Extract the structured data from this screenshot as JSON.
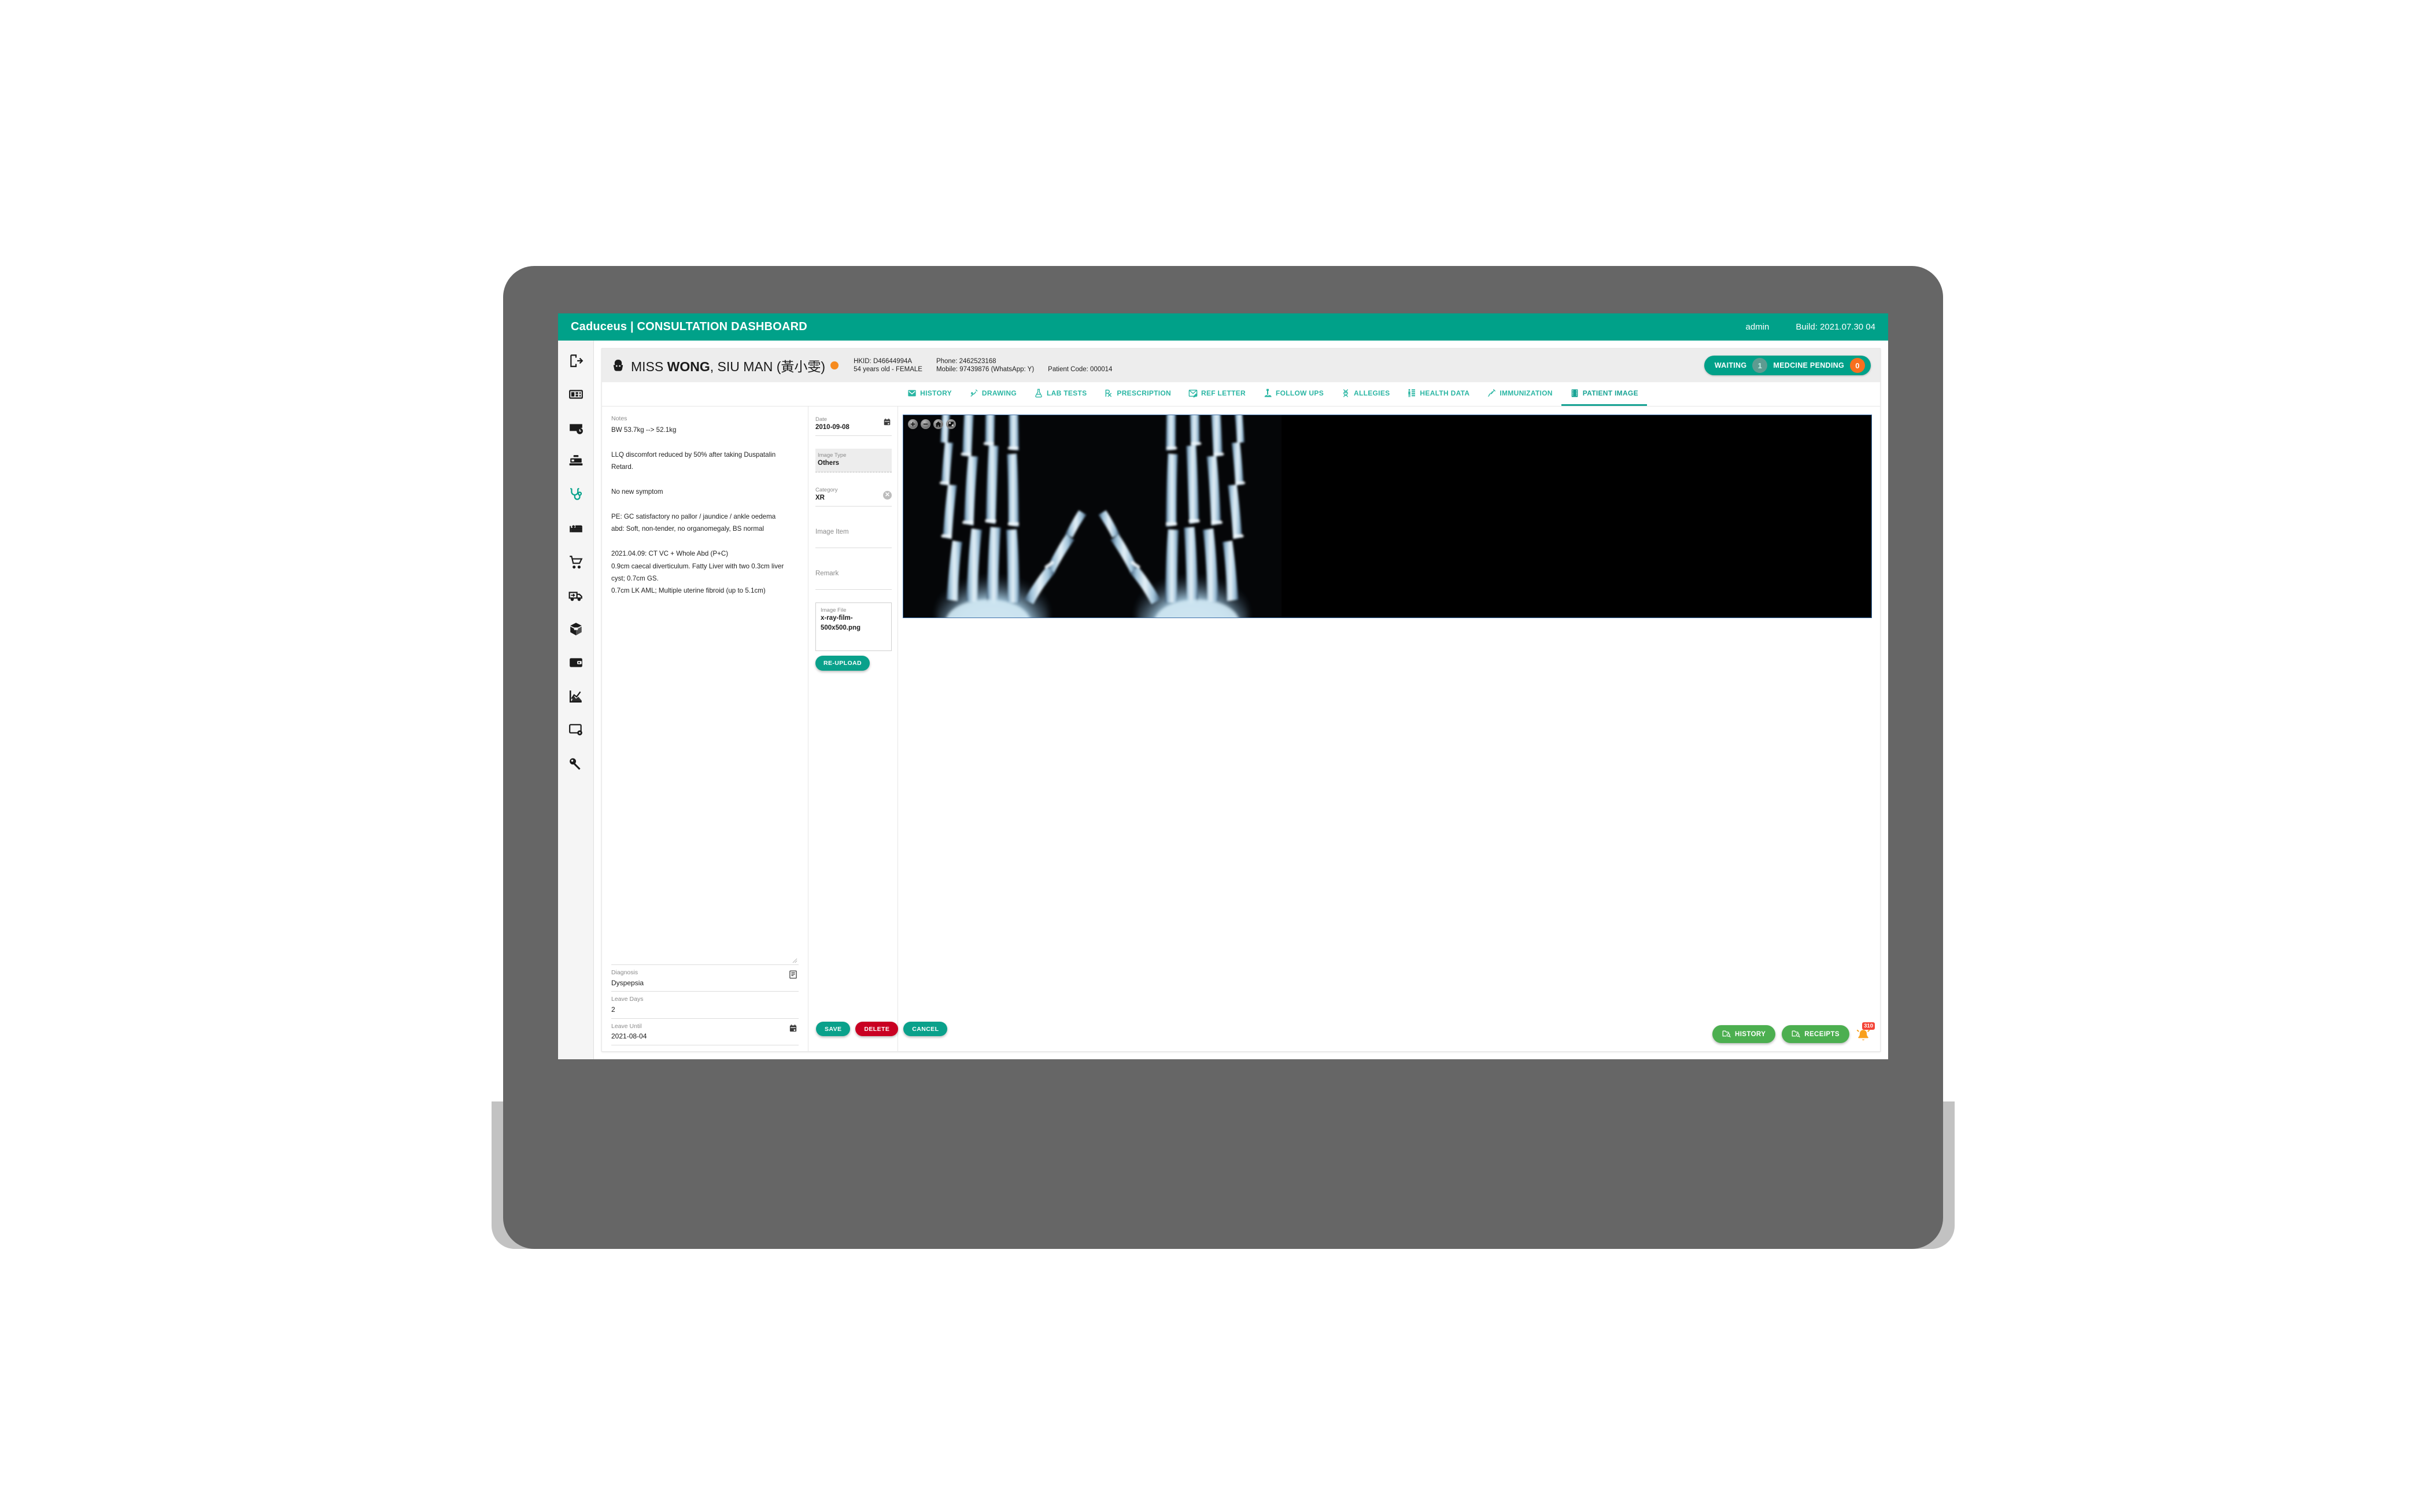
{
  "appbar": {
    "brand_prefix": "Caduceus | ",
    "brand_title": "CONSULTATION DASHBOARD",
    "brand_full": "Caduceus | CONSULTATION DASHBOARD",
    "user": "admin",
    "build": "Build: 2021.07.30 04"
  },
  "sidebar": {
    "items": [
      {
        "name": "logout-icon",
        "label": "Logout"
      },
      {
        "name": "dashboard-icon",
        "label": "Dashboard"
      },
      {
        "name": "appointment-icon",
        "label": "Appointments"
      },
      {
        "name": "cashier-icon",
        "label": "Cashier"
      },
      {
        "name": "stethoscope-icon",
        "label": "Consultation"
      },
      {
        "name": "bed-icon",
        "label": "Ward"
      },
      {
        "name": "cart-icon",
        "label": "Purchase"
      },
      {
        "name": "delivery-icon",
        "label": "Delivery"
      },
      {
        "name": "package-icon",
        "label": "Inventory"
      },
      {
        "name": "wallet-icon",
        "label": "Accounts"
      },
      {
        "name": "chart-icon",
        "label": "Reports"
      },
      {
        "name": "settings-icon",
        "label": "Settings"
      },
      {
        "name": "key-icon",
        "label": "Permissions"
      }
    ],
    "active_index": 4
  },
  "patient": {
    "title": "MISS ",
    "surname": "WONG",
    "given": ", SIU MAN (黃小雯)",
    "full_name": "MISS WONG, SIU MAN (黃小雯)",
    "hkid": "HKID: D46644994A",
    "age_sex": "54 years old - FEMALE",
    "phone": "Phone: 2462523168",
    "mobile": "Mobile: 97439876 (WhatsApp: Y)",
    "patient_code": "Patient Code: 000014",
    "status_dot_color": "#f68b1f",
    "badges": {
      "waiting_label": "WAITING",
      "waiting_count": "1",
      "pending_label": "MEDCINE PENDING",
      "pending_count": "0"
    }
  },
  "tabs": [
    {
      "label": "HISTORY",
      "icon": "envelope-icon",
      "active": false
    },
    {
      "label": "DRAWING",
      "icon": "pen-icon",
      "active": false
    },
    {
      "label": "LAB TESTS",
      "icon": "flask-icon",
      "active": false
    },
    {
      "label": "PRESCRIPTION",
      "icon": "rx-icon",
      "active": false
    },
    {
      "label": "REF LETTER",
      "icon": "letter-edit-icon",
      "active": false
    },
    {
      "label": "FOLLOW UPS",
      "icon": "person-pin-icon",
      "active": false
    },
    {
      "label": "ALLEGIES",
      "icon": "dna-icon",
      "active": false
    },
    {
      "label": "HEALTH DATA",
      "icon": "body-chart-icon",
      "active": false
    },
    {
      "label": "IMMUNIZATION",
      "icon": "syringe-icon",
      "active": false
    },
    {
      "label": "PATIENT IMAGE",
      "icon": "film-icon",
      "active": true
    }
  ],
  "notes": {
    "label": "Notes",
    "text": "BW 53.7kg --> 52.1kg\n\nLLQ discomfort reduced by 50% after taking Duspatalin Retard.\n\nNo new symptom\n\nPE: GC satisfactory no pallor / jaundice / ankle oedema\nabd: Soft, non-tender, no organomegaly, BS normal\n\n2021.04.09: CT VC + Whole Abd (P+C)\n0.9cm caecal diverticulum. Fatty Liver with two 0.3cm liver cyst; 0.7cm GS.\n0.7cm LK AML; Multiple uterine fibroid (up to 5.1cm)"
  },
  "diagnosis": {
    "label": "Diagnosis",
    "value": "Dyspepsia"
  },
  "leave_days": {
    "label": "Leave Days",
    "value": "2"
  },
  "leave_until": {
    "label": "Leave Until",
    "value": "2021-08-04"
  },
  "image_form": {
    "date": {
      "label": "Date",
      "value": "2010-09-08"
    },
    "image_type": {
      "label": "Image Type",
      "value": "Others"
    },
    "category": {
      "label": "Category",
      "value": "XR"
    },
    "image_item": {
      "label": "Image Item",
      "value": ""
    },
    "remark": {
      "label": "Remark",
      "value": ""
    },
    "image_file": {
      "label": "Image File",
      "value": "x-ray-film-500x500.png"
    },
    "reupload_label": "RE-UPLOAD"
  },
  "viewer": {
    "tools": [
      {
        "name": "zoom-in-icon",
        "label": "Zoom In"
      },
      {
        "name": "zoom-out-icon",
        "label": "Zoom Out"
      },
      {
        "name": "home-icon",
        "label": "Reset View"
      },
      {
        "name": "fit-icon",
        "label": "Fit To Window"
      }
    ],
    "image_alt": "Bilateral hand X-ray film"
  },
  "actions": {
    "save": "SAVE",
    "delete": "DELETE",
    "cancel": "CANCEL"
  },
  "bottom_right": {
    "history": "HISTORY",
    "receipts": "RECEIPTS",
    "notification_count": "310"
  },
  "colors": {
    "brand_teal": "#00a189",
    "tab_teal": "#2ab6a3",
    "orange": "#f68b1f",
    "danger_red": "#c90022",
    "green": "#4caf50",
    "badge_red": "#f44336"
  }
}
